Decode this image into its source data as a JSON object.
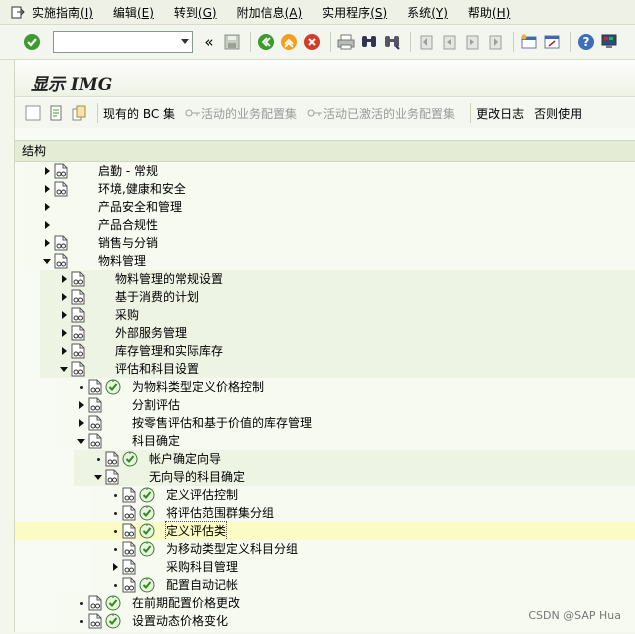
{
  "menu": {
    "items": [
      {
        "label": "实施指南",
        "hotkey": "(I)"
      },
      {
        "label": "编辑",
        "hotkey": "(E)"
      },
      {
        "label": "转到",
        "hotkey": "(G)"
      },
      {
        "label": "附加信息",
        "hotkey": "(A)"
      },
      {
        "label": "实用程序",
        "hotkey": "(S)"
      },
      {
        "label": "系统",
        "hotkey": "(Y)"
      },
      {
        "label": "帮助",
        "hotkey": "(H)"
      }
    ]
  },
  "toolbar": {
    "command_value": "",
    "collapse_glyph": "«"
  },
  "page": {
    "title": "显示 IMG"
  },
  "apptb": {
    "existing_bc_sets": "现有的 BC 集",
    "active_bc_sets": "活动的业务配置集",
    "activated_bc_sets": "活动已激活的业务配置集",
    "change_log": "更改日志",
    "release_notes": "否则使用"
  },
  "tree": {
    "header": "结构",
    "rows": [
      {
        "level": 0,
        "exp": "right",
        "doc": true,
        "clock": false,
        "label": "启勤 - 常规"
      },
      {
        "level": 0,
        "exp": "right",
        "doc": true,
        "clock": false,
        "label": "环境,健康和安全"
      },
      {
        "level": 0,
        "exp": "right",
        "doc": false,
        "clock": false,
        "label": "产品安全和管理"
      },
      {
        "level": 0,
        "exp": "right",
        "doc": false,
        "clock": false,
        "label": "产品合规性"
      },
      {
        "level": 0,
        "exp": "right",
        "doc": true,
        "clock": false,
        "label": "销售与分销"
      },
      {
        "level": 0,
        "exp": "down",
        "doc": true,
        "clock": false,
        "label": "物料管理"
      },
      {
        "level": 1,
        "exp": "right",
        "doc": true,
        "clock": false,
        "label": "物料管理的常规设置"
      },
      {
        "level": 1,
        "exp": "right",
        "doc": true,
        "clock": false,
        "label": "基于消费的计划"
      },
      {
        "level": 1,
        "exp": "right",
        "doc": true,
        "clock": false,
        "label": "采购"
      },
      {
        "level": 1,
        "exp": "right",
        "doc": true,
        "clock": false,
        "label": "外部服务管理"
      },
      {
        "level": 1,
        "exp": "right",
        "doc": true,
        "clock": false,
        "label": "库存管理和实际库存"
      },
      {
        "level": 1,
        "exp": "down",
        "doc": true,
        "clock": false,
        "label": "评估和科目设置"
      },
      {
        "level": 2,
        "exp": "dot",
        "doc": true,
        "clock": true,
        "label": "为物料类型定义价格控制"
      },
      {
        "level": 2,
        "exp": "right",
        "doc": true,
        "clock": false,
        "label": "分割评估"
      },
      {
        "level": 2,
        "exp": "right",
        "doc": true,
        "clock": false,
        "label": "按零售评估和基于价值的库存管理"
      },
      {
        "level": 2,
        "exp": "down",
        "doc": true,
        "clock": false,
        "label": "科目确定"
      },
      {
        "level": 3,
        "exp": "dot",
        "doc": true,
        "clock": true,
        "label": "帐户确定向导"
      },
      {
        "level": 3,
        "exp": "down",
        "doc": true,
        "clock": false,
        "label": "无向导的科目确定"
      },
      {
        "level": 4,
        "exp": "dot",
        "doc": true,
        "clock": true,
        "label": "定义评估控制"
      },
      {
        "level": 4,
        "exp": "dot",
        "doc": true,
        "clock": true,
        "label": "将评估范围群集分组"
      },
      {
        "level": 4,
        "exp": "dot",
        "doc": true,
        "clock": true,
        "label": "定义评估类",
        "selected": true
      },
      {
        "level": 4,
        "exp": "dot",
        "doc": true,
        "clock": true,
        "label": "为移动类型定义科目分组"
      },
      {
        "level": 4,
        "exp": "right",
        "doc": true,
        "clock": false,
        "label": "采购科目管理"
      },
      {
        "level": 4,
        "exp": "dot",
        "doc": true,
        "clock": true,
        "label": "配置自动记帐"
      },
      {
        "level": 2,
        "exp": "dot",
        "doc": true,
        "clock": true,
        "label": "在前期配置价格更改"
      },
      {
        "level": 2,
        "exp": "dot",
        "doc": true,
        "clock": true,
        "label": "设置动态价格变化"
      }
    ]
  },
  "watermark": "CSDN @SAP Hua"
}
